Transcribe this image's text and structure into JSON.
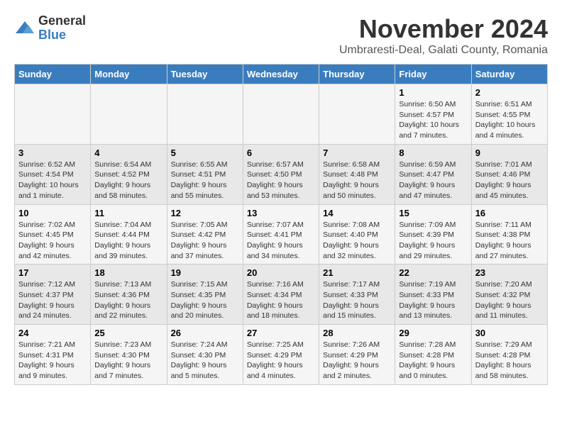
{
  "logo": {
    "line1": "General",
    "line2": "Blue"
  },
  "title": "November 2024",
  "subtitle": "Umbraresti-Deal, Galati County, Romania",
  "headers": [
    "Sunday",
    "Monday",
    "Tuesday",
    "Wednesday",
    "Thursday",
    "Friday",
    "Saturday"
  ],
  "weeks": [
    [
      {
        "day": "",
        "info": ""
      },
      {
        "day": "",
        "info": ""
      },
      {
        "day": "",
        "info": ""
      },
      {
        "day": "",
        "info": ""
      },
      {
        "day": "",
        "info": ""
      },
      {
        "day": "1",
        "info": "Sunrise: 6:50 AM\nSunset: 4:57 PM\nDaylight: 10 hours and 7 minutes."
      },
      {
        "day": "2",
        "info": "Sunrise: 6:51 AM\nSunset: 4:55 PM\nDaylight: 10 hours and 4 minutes."
      }
    ],
    [
      {
        "day": "3",
        "info": "Sunrise: 6:52 AM\nSunset: 4:54 PM\nDaylight: 10 hours and 1 minute."
      },
      {
        "day": "4",
        "info": "Sunrise: 6:54 AM\nSunset: 4:52 PM\nDaylight: 9 hours and 58 minutes."
      },
      {
        "day": "5",
        "info": "Sunrise: 6:55 AM\nSunset: 4:51 PM\nDaylight: 9 hours and 55 minutes."
      },
      {
        "day": "6",
        "info": "Sunrise: 6:57 AM\nSunset: 4:50 PM\nDaylight: 9 hours and 53 minutes."
      },
      {
        "day": "7",
        "info": "Sunrise: 6:58 AM\nSunset: 4:48 PM\nDaylight: 9 hours and 50 minutes."
      },
      {
        "day": "8",
        "info": "Sunrise: 6:59 AM\nSunset: 4:47 PM\nDaylight: 9 hours and 47 minutes."
      },
      {
        "day": "9",
        "info": "Sunrise: 7:01 AM\nSunset: 4:46 PM\nDaylight: 9 hours and 45 minutes."
      }
    ],
    [
      {
        "day": "10",
        "info": "Sunrise: 7:02 AM\nSunset: 4:45 PM\nDaylight: 9 hours and 42 minutes."
      },
      {
        "day": "11",
        "info": "Sunrise: 7:04 AM\nSunset: 4:44 PM\nDaylight: 9 hours and 39 minutes."
      },
      {
        "day": "12",
        "info": "Sunrise: 7:05 AM\nSunset: 4:42 PM\nDaylight: 9 hours and 37 minutes."
      },
      {
        "day": "13",
        "info": "Sunrise: 7:07 AM\nSunset: 4:41 PM\nDaylight: 9 hours and 34 minutes."
      },
      {
        "day": "14",
        "info": "Sunrise: 7:08 AM\nSunset: 4:40 PM\nDaylight: 9 hours and 32 minutes."
      },
      {
        "day": "15",
        "info": "Sunrise: 7:09 AM\nSunset: 4:39 PM\nDaylight: 9 hours and 29 minutes."
      },
      {
        "day": "16",
        "info": "Sunrise: 7:11 AM\nSunset: 4:38 PM\nDaylight: 9 hours and 27 minutes."
      }
    ],
    [
      {
        "day": "17",
        "info": "Sunrise: 7:12 AM\nSunset: 4:37 PM\nDaylight: 9 hours and 24 minutes."
      },
      {
        "day": "18",
        "info": "Sunrise: 7:13 AM\nSunset: 4:36 PM\nDaylight: 9 hours and 22 minutes."
      },
      {
        "day": "19",
        "info": "Sunrise: 7:15 AM\nSunset: 4:35 PM\nDaylight: 9 hours and 20 minutes."
      },
      {
        "day": "20",
        "info": "Sunrise: 7:16 AM\nSunset: 4:34 PM\nDaylight: 9 hours and 18 minutes."
      },
      {
        "day": "21",
        "info": "Sunrise: 7:17 AM\nSunset: 4:33 PM\nDaylight: 9 hours and 15 minutes."
      },
      {
        "day": "22",
        "info": "Sunrise: 7:19 AM\nSunset: 4:33 PM\nDaylight: 9 hours and 13 minutes."
      },
      {
        "day": "23",
        "info": "Sunrise: 7:20 AM\nSunset: 4:32 PM\nDaylight: 9 hours and 11 minutes."
      }
    ],
    [
      {
        "day": "24",
        "info": "Sunrise: 7:21 AM\nSunset: 4:31 PM\nDaylight: 9 hours and 9 minutes."
      },
      {
        "day": "25",
        "info": "Sunrise: 7:23 AM\nSunset: 4:30 PM\nDaylight: 9 hours and 7 minutes."
      },
      {
        "day": "26",
        "info": "Sunrise: 7:24 AM\nSunset: 4:30 PM\nDaylight: 9 hours and 5 minutes."
      },
      {
        "day": "27",
        "info": "Sunrise: 7:25 AM\nSunset: 4:29 PM\nDaylight: 9 hours and 4 minutes."
      },
      {
        "day": "28",
        "info": "Sunrise: 7:26 AM\nSunset: 4:29 PM\nDaylight: 9 hours and 2 minutes."
      },
      {
        "day": "29",
        "info": "Sunrise: 7:28 AM\nSunset: 4:28 PM\nDaylight: 9 hours and 0 minutes."
      },
      {
        "day": "30",
        "info": "Sunrise: 7:29 AM\nSunset: 4:28 PM\nDaylight: 8 hours and 58 minutes."
      }
    ]
  ]
}
